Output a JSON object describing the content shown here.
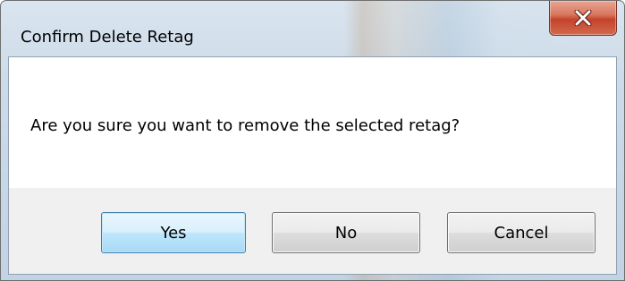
{
  "dialog": {
    "title": "Confirm Delete Retag",
    "message": "Are you sure you want to remove the selected retag?",
    "close_icon": "close-icon",
    "buttons": {
      "yes": "Yes",
      "no": "No",
      "cancel": "Cancel"
    },
    "default_button": "yes",
    "colors": {
      "close_button": "#c4432a",
      "default_button_border": "#3c7fb1",
      "button_area": "#f0f0f0"
    }
  }
}
